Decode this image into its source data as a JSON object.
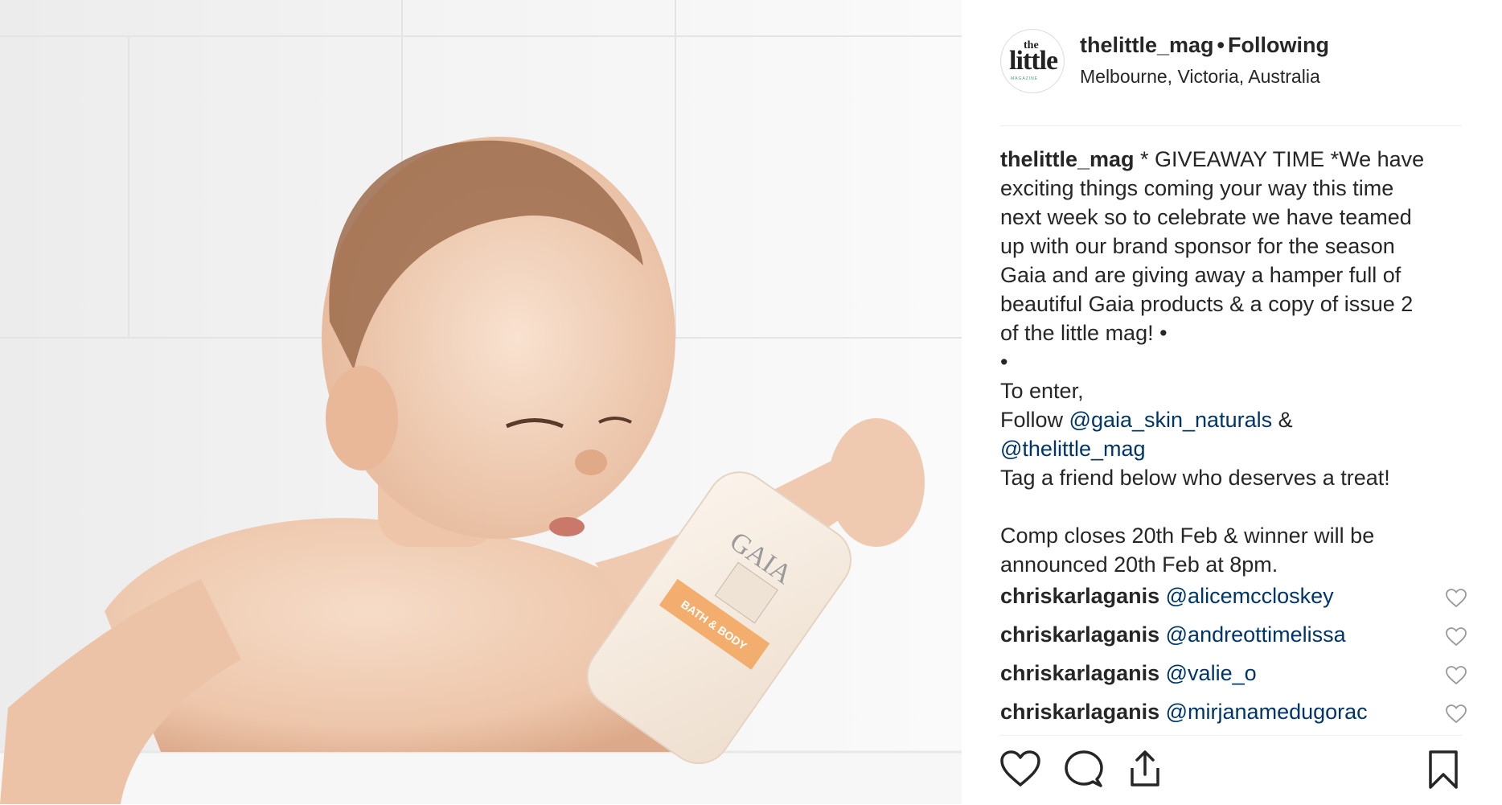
{
  "post": {
    "author": {
      "username": "thelittle_mag",
      "separator": "•",
      "follow_status": "Following",
      "location": "Melbourne, Victoria, Australia",
      "avatar": {
        "line1": "the",
        "line2": "little",
        "line3": "MAGAZINE"
      }
    },
    "photo": {
      "icon": "photo",
      "bottle_brand": "GAIA",
      "bottle_label": "BATH & BODY"
    },
    "caption": {
      "username": "thelittle_mag",
      "lines": [
        " * GIVEAWAY TIME *We have",
        "exciting things coming your way this time",
        "next week so to celebrate we have teamed",
        "up with our brand sponsor for the season",
        "Gaia and are giving away a hamper full of",
        "beautiful Gaia products & a copy of issue 2",
        "of the little mag! •",
        "•",
        "To enter,"
      ],
      "follow_prefix": "Follow ",
      "mention_1": "@gaia_skin_naturals",
      "amp": " &",
      "mention_2": "@thelittle_mag",
      "tag_line": "Tag a friend below who deserves a treat!",
      "comp_line_1": "Comp closes 20th Feb & winner will be",
      "comp_line_2": "announced 20th Feb at 8pm."
    },
    "comments": [
      {
        "username": "chriskarlaganis",
        "mention": "@alicemccloskey"
      },
      {
        "username": "chriskarlaganis",
        "mention": "@andreottimelissa"
      },
      {
        "username": "chriskarlaganis",
        "mention": "@valie_o"
      },
      {
        "username": "chriskarlaganis",
        "mention": "@mirjanamedugorac"
      }
    ],
    "actions": {
      "like_icon": "heart-icon",
      "comment_icon": "speech-bubble-icon",
      "share_icon": "share-icon",
      "save_icon": "bookmark-icon"
    }
  },
  "colors": {
    "text": "#262626",
    "mention": "#003569",
    "divider": "#efefef"
  }
}
